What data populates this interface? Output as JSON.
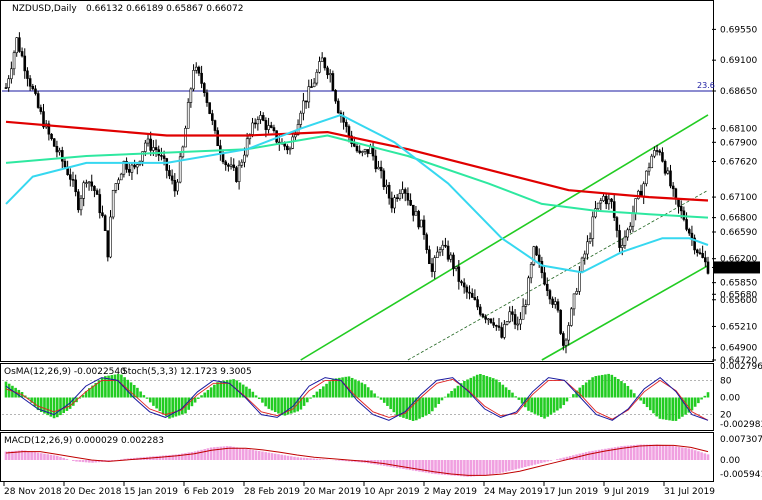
{
  "symbol_header": "NZDUSD,Daily",
  "ohlc_header": "0.66132 0.66189 0.65867 0.66072",
  "osma_header": "OsMA(12,26,9) -0.0022540",
  "stoch_header": "Stoch(5,3,3) 12.1723 9.3005",
  "macd_header": "MACD(12,26,9) 0.000029 0.002283",
  "fib_label": "23.6",
  "colors": {
    "background": "#ffffff",
    "candle": "#000000",
    "ema200": "#e00000",
    "ema144": "#2ee8a0",
    "ema50": "#36d8f0",
    "channel": "#22cc22",
    "fib_line": "#1a1aa0",
    "osma": "#22cc22",
    "macd_hist": "#f0a0e0",
    "macd_signal": "#c00000",
    "stoch_main": "#1a1aa0",
    "stoch_signal": "#e02020",
    "current_price_box": "#000000"
  },
  "chart_data": [
    {
      "type": "candlestick",
      "panel": "main",
      "symbol": "NZDUSD",
      "timeframe": "Daily",
      "ylim": [
        0.6472,
        0.6995
      ],
      "price_labels": [
        "0.69550",
        "0.69100",
        "0.68650",
        "0.68100",
        "0.67900",
        "0.67620",
        "0.67100",
        "0.66800",
        "0.66590",
        "0.66200",
        "0.66072",
        "0.65850",
        "0.65680",
        "0.65600",
        "0.65210",
        "0.64900",
        "0.64720"
      ],
      "current_price": 0.66072,
      "fib_level": {
        "label": "23.6",
        "price": 0.6865
      },
      "x_labels": [
        "28 Nov 2018",
        "20 Dec 2018",
        "15 Jan 2019",
        "6 Feb 2019",
        "28 Feb 2019",
        "20 Mar 2019",
        "10 Apr 2019",
        "2 May 2019",
        "24 May 2019",
        "17 Jun 2019",
        "9 Jul 2019",
        "31 Jul 2019"
      ],
      "close_path": [
        [
          0,
          0.687
        ],
        [
          4,
          0.694
        ],
        [
          8,
          0.689
        ],
        [
          12,
          0.684
        ],
        [
          16,
          0.68
        ],
        [
          20,
          0.677
        ],
        [
          24,
          0.674
        ],
        [
          27,
          0.67
        ],
        [
          30,
          0.674
        ],
        [
          33,
          0.672
        ],
        [
          36,
          0.668
        ],
        [
          38,
          0.663
        ],
        [
          40,
          0.672
        ],
        [
          44,
          0.676
        ],
        [
          48,
          0.675
        ],
        [
          52,
          0.679
        ],
        [
          56,
          0.678
        ],
        [
          60,
          0.675
        ],
        [
          63,
          0.672
        ],
        [
          66,
          0.678
        ],
        [
          70,
          0.69
        ],
        [
          74,
          0.687
        ],
        [
          78,
          0.68
        ],
        [
          82,
          0.676
        ],
        [
          86,
          0.674
        ],
        [
          90,
          0.679
        ],
        [
          94,
          0.683
        ],
        [
          98,
          0.681
        ],
        [
          102,
          0.679
        ],
        [
          106,
          0.678
        ],
        [
          110,
          0.684
        ],
        [
          114,
          0.687
        ],
        [
          118,
          0.691
        ],
        [
          121,
          0.689
        ],
        [
          124,
          0.684
        ],
        [
          128,
          0.68
        ],
        [
          132,
          0.677
        ],
        [
          136,
          0.678
        ],
        [
          140,
          0.674
        ],
        [
          144,
          0.67
        ],
        [
          148,
          0.673
        ],
        [
          152,
          0.669
        ],
        [
          156,
          0.666
        ],
        [
          159,
          0.66
        ],
        [
          162,
          0.664
        ],
        [
          166,
          0.662
        ],
        [
          170,
          0.658
        ],
        [
          174,
          0.656
        ],
        [
          178,
          0.654
        ],
        [
          182,
          0.653
        ],
        [
          185,
          0.6505
        ],
        [
          188,
          0.654
        ],
        [
          191,
          0.652
        ],
        [
          194,
          0.656
        ],
        [
          197,
          0.663
        ],
        [
          200,
          0.66
        ],
        [
          203,
          0.657
        ],
        [
          206,
          0.654
        ],
        [
          208,
          0.6495
        ],
        [
          211,
          0.654
        ],
        [
          214,
          0.66
        ],
        [
          217,
          0.664
        ],
        [
          220,
          0.669
        ],
        [
          223,
          0.671
        ],
        [
          226,
          0.67
        ],
        [
          229,
          0.664
        ],
        [
          232,
          0.666
        ],
        [
          235,
          0.67
        ],
        [
          238,
          0.673
        ],
        [
          241,
          0.677
        ],
        [
          244,
          0.678
        ],
        [
          247,
          0.674
        ],
        [
          250,
          0.67
        ],
        [
          253,
          0.668
        ],
        [
          256,
          0.665
        ],
        [
          259,
          0.6625
        ],
        [
          262,
          0.6607
        ]
      ],
      "series": [
        {
          "name": "ema200",
          "values": [
            [
              0,
              0.682
            ],
            [
              30,
              0.681
            ],
            [
              60,
              0.68
            ],
            [
              90,
              0.68
            ],
            [
              120,
              0.6805
            ],
            [
              150,
              0.678
            ],
            [
              180,
              0.675
            ],
            [
              210,
              0.672
            ],
            [
              240,
              0.671
            ],
            [
              262,
              0.6705
            ]
          ]
        },
        {
          "name": "ema144",
          "values": [
            [
              0,
              0.676
            ],
            [
              30,
              0.677
            ],
            [
              60,
              0.6775
            ],
            [
              90,
              0.678
            ],
            [
              120,
              0.68
            ],
            [
              150,
              0.677
            ],
            [
              180,
              0.673
            ],
            [
              200,
              0.67
            ],
            [
              220,
              0.669
            ],
            [
              240,
              0.6685
            ],
            [
              262,
              0.668
            ]
          ]
        },
        {
          "name": "ema50",
          "values": [
            [
              0,
              0.67
            ],
            [
              10,
              0.674
            ],
            [
              30,
              0.676
            ],
            [
              60,
              0.676
            ],
            [
              90,
              0.678
            ],
            [
              110,
              0.681
            ],
            [
              125,
              0.683
            ],
            [
              145,
              0.679
            ],
            [
              165,
              0.673
            ],
            [
              185,
              0.665
            ],
            [
              200,
              0.661
            ],
            [
              215,
              0.66
            ],
            [
              230,
              0.663
            ],
            [
              245,
              0.665
            ],
            [
              255,
              0.665
            ],
            [
              262,
              0.664
            ]
          ]
        }
      ]
    },
    {
      "type": "bar",
      "panel": "osma_stoch",
      "ylim_labels": [
        "0.0027969",
        "80",
        "0.00",
        "20",
        "-0.0029839"
      ],
      "osma_values": [
        0.6,
        0.2,
        -0.5,
        -0.8,
        -0.4,
        0.3,
        0.8,
        0.9,
        0.4,
        -0.3,
        -0.8,
        -0.6,
        0.1,
        0.6,
        0.7,
        0.3,
        -0.4,
        -0.7,
        -0.5,
        0.2,
        0.7,
        0.8,
        0.5,
        -0.1,
        -0.7,
        -0.9,
        -0.6,
        0.1,
        0.6,
        0.9,
        0.7,
        0.2,
        -0.5,
        -0.8,
        -0.4,
        0.3,
        0.8,
        0.9,
        0.5,
        -0.2,
        -0.8,
        -0.9,
        -0.5,
        0.2
      ],
      "stoch_main": [
        70,
        50,
        30,
        20,
        40,
        70,
        85,
        80,
        50,
        25,
        15,
        30,
        60,
        80,
        75,
        50,
        20,
        15,
        35,
        70,
        85,
        80,
        45,
        20,
        10,
        25,
        55,
        80,
        85,
        60,
        30,
        15,
        25,
        60,
        85,
        80,
        50,
        20,
        10,
        30,
        65,
        85,
        60,
        20,
        10
      ],
      "stoch_signal": [
        65,
        55,
        35,
        25,
        35,
        60,
        80,
        80,
        55,
        30,
        20,
        28,
        55,
        75,
        75,
        52,
        25,
        18,
        30,
        62,
        80,
        80,
        50,
        25,
        15,
        22,
        50,
        75,
        82,
        62,
        35,
        18,
        22,
        55,
        80,
        80,
        55,
        25,
        12,
        28,
        60,
        80,
        62,
        25,
        10
      ]
    },
    {
      "type": "bar",
      "panel": "macd",
      "ylim_labels": [
        "0.007307",
        "0.00",
        "-0.005941"
      ],
      "histogram": [
        0.3,
        0.35,
        0.25,
        0.15,
        -0.05,
        -0.1,
        -0.05,
        0.05,
        0.1,
        0.15,
        0.2,
        0.3,
        0.45,
        0.5,
        0.4,
        0.3,
        0.2,
        0.1,
        0.05,
        0.0,
        -0.05,
        -0.1,
        -0.2,
        -0.3,
        -0.4,
        -0.5,
        -0.55,
        -0.6,
        -0.55,
        -0.45,
        -0.3,
        -0.15,
        0.0,
        0.15,
        0.3,
        0.4,
        0.5,
        0.55,
        0.55,
        0.5,
        0.4,
        0.2
      ],
      "signal": [
        0.25,
        0.3,
        0.3,
        0.2,
        0.1,
        0.0,
        -0.05,
        0.0,
        0.05,
        0.1,
        0.15,
        0.22,
        0.35,
        0.42,
        0.42,
        0.36,
        0.28,
        0.18,
        0.1,
        0.05,
        0.0,
        -0.05,
        -0.12,
        -0.22,
        -0.32,
        -0.42,
        -0.5,
        -0.55,
        -0.55,
        -0.5,
        -0.4,
        -0.25,
        -0.1,
        0.05,
        0.2,
        0.32,
        0.42,
        0.5,
        0.53,
        0.52,
        0.45,
        0.3
      ]
    }
  ]
}
